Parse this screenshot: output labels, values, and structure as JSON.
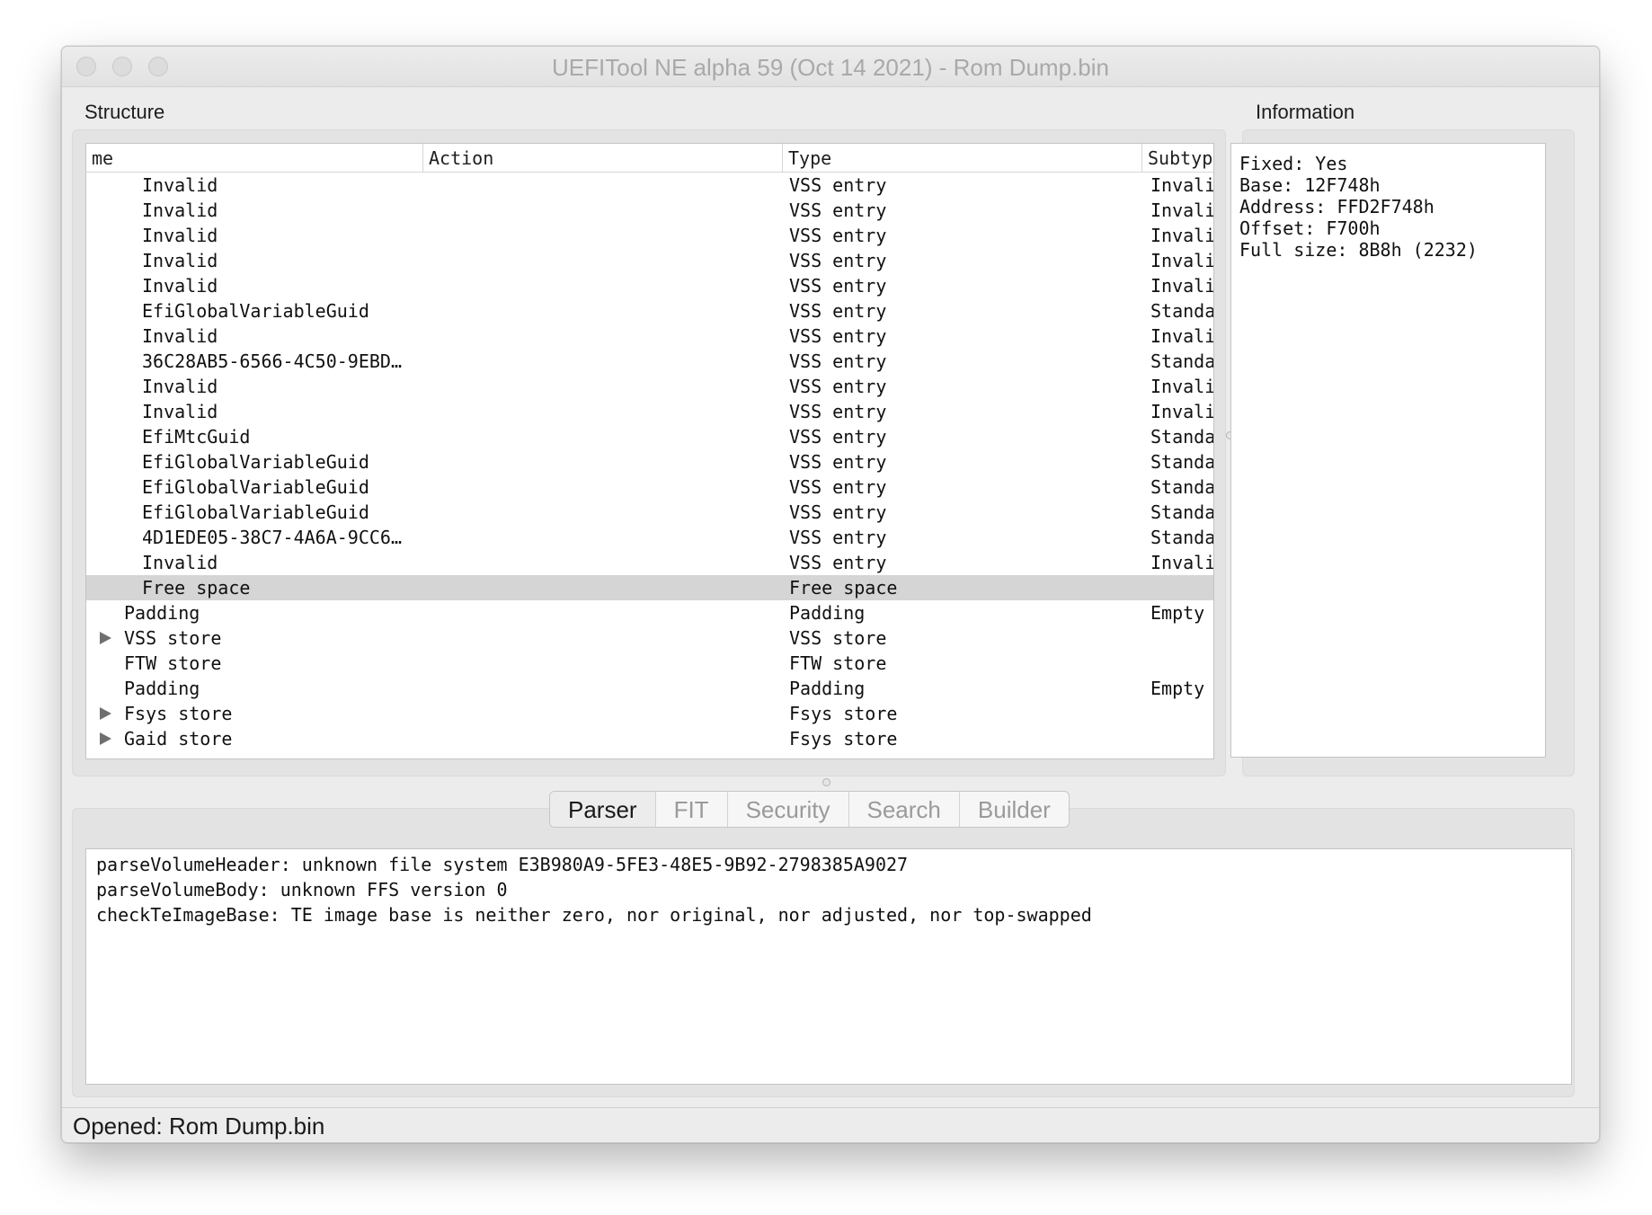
{
  "window": {
    "title": "UEFITool NE alpha 59 (Oct 14 2021) - Rom Dump.bin"
  },
  "structure": {
    "label": "Structure",
    "columns": [
      "me",
      "Action",
      "Type",
      "Subtyp"
    ],
    "rows": [
      {
        "name": "Invalid",
        "type": "VSS entry",
        "subtype": "Invali",
        "indent": 2,
        "expander": false,
        "selected": false
      },
      {
        "name": "Invalid",
        "type": "VSS entry",
        "subtype": "Invali",
        "indent": 2,
        "expander": false,
        "selected": false
      },
      {
        "name": "Invalid",
        "type": "VSS entry",
        "subtype": "Invali",
        "indent": 2,
        "expander": false,
        "selected": false
      },
      {
        "name": "Invalid",
        "type": "VSS entry",
        "subtype": "Invali",
        "indent": 2,
        "expander": false,
        "selected": false
      },
      {
        "name": "Invalid",
        "type": "VSS entry",
        "subtype": "Invali",
        "indent": 2,
        "expander": false,
        "selected": false
      },
      {
        "name": "EfiGlobalVariableGuid",
        "type": "VSS entry",
        "subtype": "Standa",
        "indent": 2,
        "expander": false,
        "selected": false
      },
      {
        "name": "Invalid",
        "type": "VSS entry",
        "subtype": "Invali",
        "indent": 2,
        "expander": false,
        "selected": false
      },
      {
        "name": "36C28AB5-6566-4C50-9EBD…",
        "type": "VSS entry",
        "subtype": "Standa",
        "indent": 2,
        "expander": false,
        "selected": false
      },
      {
        "name": "Invalid",
        "type": "VSS entry",
        "subtype": "Invali",
        "indent": 2,
        "expander": false,
        "selected": false
      },
      {
        "name": "Invalid",
        "type": "VSS entry",
        "subtype": "Invali",
        "indent": 2,
        "expander": false,
        "selected": false
      },
      {
        "name": "EfiMtcGuid",
        "type": "VSS entry",
        "subtype": "Standa",
        "indent": 2,
        "expander": false,
        "selected": false
      },
      {
        "name": "EfiGlobalVariableGuid",
        "type": "VSS entry",
        "subtype": "Standa",
        "indent": 2,
        "expander": false,
        "selected": false
      },
      {
        "name": "EfiGlobalVariableGuid",
        "type": "VSS entry",
        "subtype": "Standa",
        "indent": 2,
        "expander": false,
        "selected": false
      },
      {
        "name": "EfiGlobalVariableGuid",
        "type": "VSS entry",
        "subtype": "Standa",
        "indent": 2,
        "expander": false,
        "selected": false
      },
      {
        "name": "4D1EDE05-38C7-4A6A-9CC6…",
        "type": "VSS entry",
        "subtype": "Standa",
        "indent": 2,
        "expander": false,
        "selected": false
      },
      {
        "name": "Invalid",
        "type": "VSS entry",
        "subtype": "Invali",
        "indent": 2,
        "expander": false,
        "selected": false
      },
      {
        "name": "Free space",
        "type": "Free space",
        "subtype": "",
        "indent": 2,
        "expander": false,
        "selected": true
      },
      {
        "name": "Padding",
        "type": "Padding",
        "subtype": "Empty",
        "indent": 1,
        "expander": false,
        "selected": false
      },
      {
        "name": "VSS store",
        "type": "VSS store",
        "subtype": "",
        "indent": 1,
        "expander": true,
        "selected": false
      },
      {
        "name": "FTW store",
        "type": "FTW store",
        "subtype": "",
        "indent": 1,
        "expander": false,
        "selected": false
      },
      {
        "name": "Padding",
        "type": "Padding",
        "subtype": "Empty",
        "indent": 1,
        "expander": false,
        "selected": false
      },
      {
        "name": "Fsys store",
        "type": "Fsys store",
        "subtype": "",
        "indent": 1,
        "expander": true,
        "selected": false
      },
      {
        "name": "Gaid store",
        "type": "Fsys store",
        "subtype": "",
        "indent": 1,
        "expander": true,
        "selected": false
      }
    ]
  },
  "information": {
    "label": "Information",
    "lines": [
      "Fixed: Yes",
      "Base: 12F748h",
      "Address: FFD2F748h",
      "Offset: F700h",
      "Full size: 8B8h (2232)"
    ]
  },
  "tabs": [
    {
      "label": "Parser",
      "active": true
    },
    {
      "label": "FIT",
      "active": false
    },
    {
      "label": "Security",
      "active": false
    },
    {
      "label": "Search",
      "active": false
    },
    {
      "label": "Builder",
      "active": false
    }
  ],
  "log": [
    "parseVolumeHeader: unknown file system E3B980A9-5FE3-48E5-9B92-2798385A9027",
    "parseVolumeBody: unknown FFS version 0",
    "checkTeImageBase: TE image base is neither zero, nor original, nor adjusted, nor top-swapped"
  ],
  "status": {
    "text": "Opened: Rom Dump.bin"
  }
}
